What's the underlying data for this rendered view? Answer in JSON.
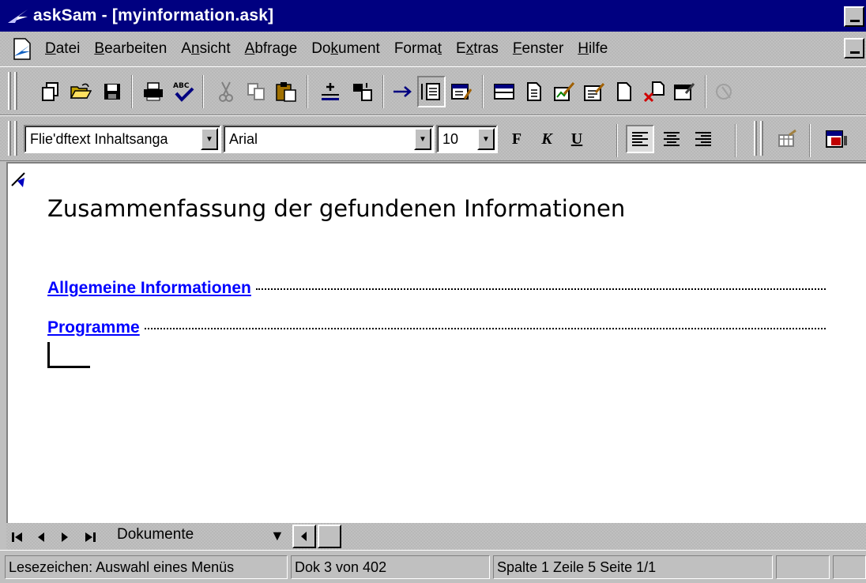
{
  "window": {
    "title": "askSam - [myinformation.ask]"
  },
  "menubar": {
    "items": [
      {
        "pre": "",
        "u": "D",
        "post": "atei"
      },
      {
        "pre": "",
        "u": "B",
        "post": "earbeiten"
      },
      {
        "pre": "A",
        "u": "n",
        "post": "sicht"
      },
      {
        "pre": "",
        "u": "A",
        "post": "bfrage"
      },
      {
        "pre": "Do",
        "u": "k",
        "post": "ument"
      },
      {
        "pre": "Forma",
        "u": "t",
        "post": ""
      },
      {
        "pre": "E",
        "u": "x",
        "post": "tras"
      },
      {
        "pre": "",
        "u": "F",
        "post": "enster"
      },
      {
        "pre": "",
        "u": "H",
        "post": "ilfe"
      }
    ]
  },
  "format_toolbar": {
    "style_value": "Flie'dftext Inhaltsanga",
    "font_value": "Arial",
    "size_value": "10",
    "bold_label": "F",
    "italic_label": "K",
    "underline_label": "U"
  },
  "document": {
    "heading": "Zusammenfassung der gefundenen Informationen",
    "toc": [
      {
        "label": "Allgemeine Informationen"
      },
      {
        "label": "Programme"
      }
    ]
  },
  "navigator": {
    "label": "Dokumente"
  },
  "statusbar": {
    "message": "Lesezeichen: Auswahl eines Menüs",
    "doc_position": "Dok 3 von 402",
    "cursor_position": "Spalte 1   Zeile 5   Seite 1/1"
  },
  "colors": {
    "titlebar": "#000080",
    "link": "#0000ff",
    "chrome": "#c0c0c0"
  }
}
